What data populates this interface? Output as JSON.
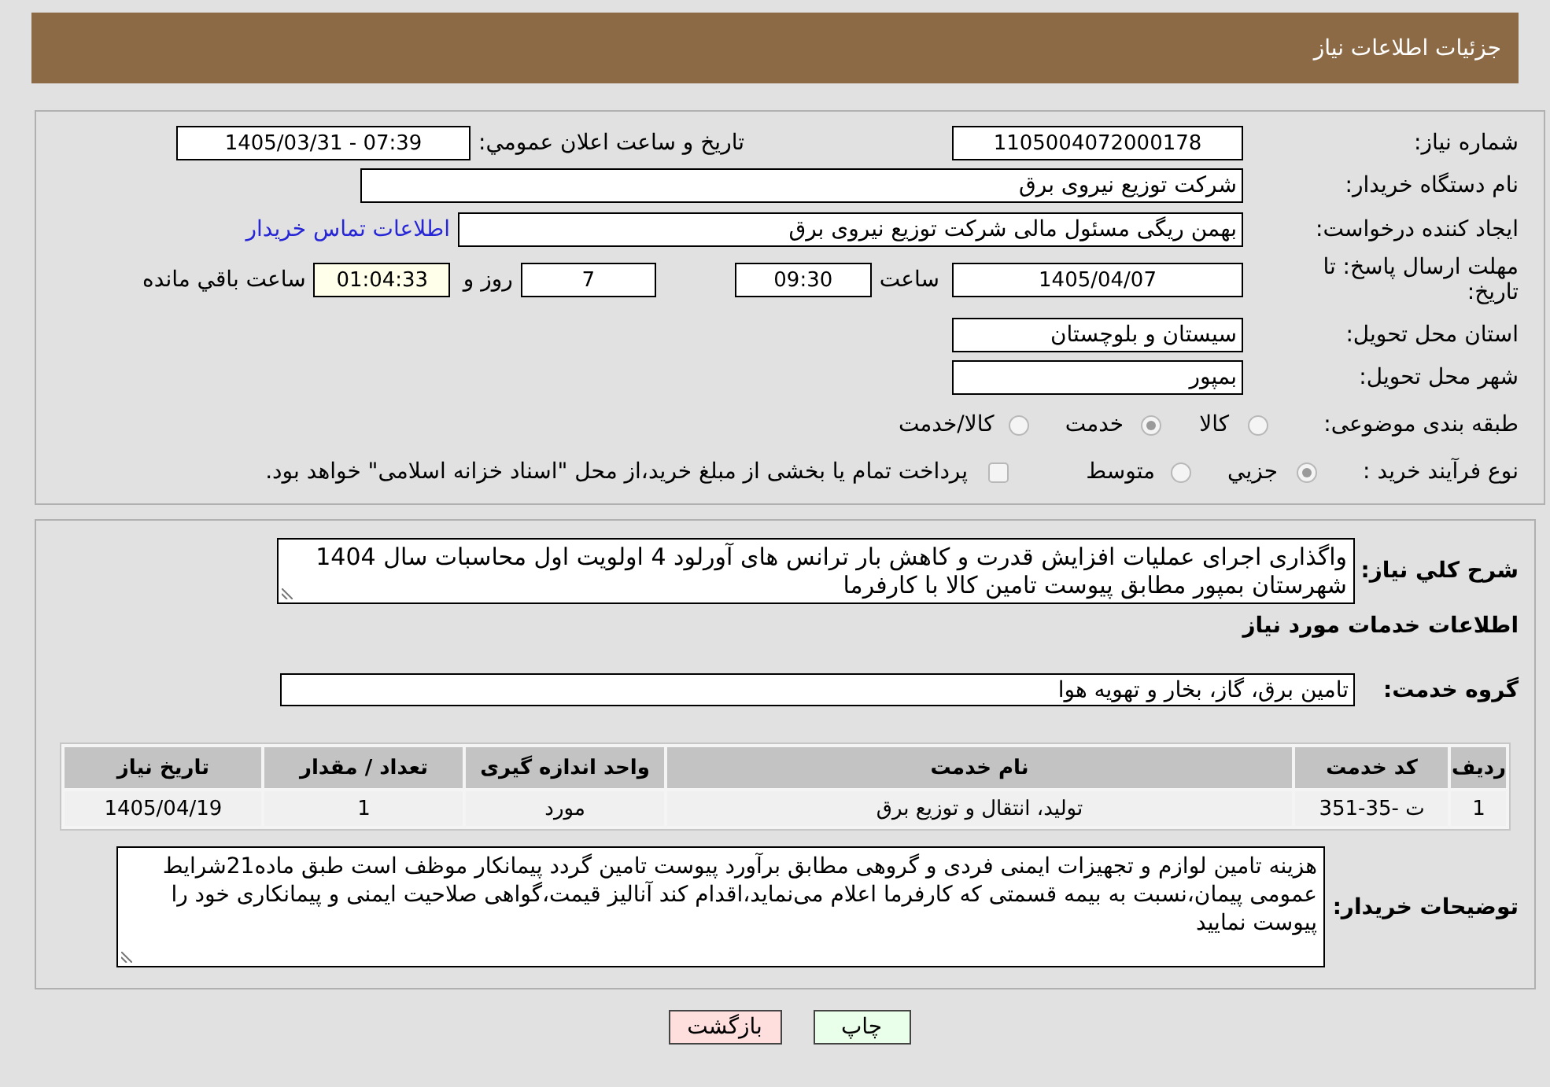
{
  "header": {
    "title": "جزئیات اطلاعات نیاز"
  },
  "details": {
    "need_number": {
      "label": "شماره نیاز:",
      "value": "1105004072000178"
    },
    "announce_datetime": {
      "label": "تاريخ و ساعت اعلان عمومي:",
      "value": "1405/03/31 - 07:39"
    },
    "buyer_org": {
      "label": "نام دستگاه خریدار:",
      "value": "شرکت توزیع نیروی برق"
    },
    "requester": {
      "label": "ایجاد کننده درخواست:",
      "value": "بهمن ریگی مسئول مالی شرکت توزیع نیروی برق",
      "link": "اطلاعات تماس خریدار"
    },
    "deadline": {
      "label": "مهلت ارسال پاسخ: تا تاریخ:",
      "date": "1405/04/07",
      "time_label": "ساعت",
      "time": "09:30",
      "days": "7",
      "days_label": "روز و",
      "remaining": "01:04:33",
      "remaining_label": "ساعت باقي مانده"
    },
    "province": {
      "label": "استان محل تحویل:",
      "value": "سیستان و بلوچستان"
    },
    "city": {
      "label": "شهر محل تحویل:",
      "value": "بمپور"
    },
    "category": {
      "label": "طبقه بندی موضوعی:",
      "options": [
        {
          "label": "کالا",
          "selected": false
        },
        {
          "label": "خدمت",
          "selected": true
        },
        {
          "label": "کالا/خدمت",
          "selected": false
        }
      ]
    },
    "purchase_type": {
      "label": "نوع فرآیند خرید :",
      "options": [
        {
          "label": "جزيي",
          "selected": true
        },
        {
          "label": "متوسط",
          "selected": false
        }
      ],
      "treasury": {
        "label": "پرداخت تمام یا بخشی از مبلغ خرید،از محل \"اسناد خزانه اسلامی\" خواهد بود.",
        "checked": false
      }
    }
  },
  "description": {
    "label": "شرح کلي نیاز:",
    "value": "واگذاری اجرای عملیات افزایش قدرت و کاهش بار ترانس های آورلود 4 اولویت اول محاسبات سال 1404 شهرستان بمپور مطابق پیوست تامین کالا با کارفرما"
  },
  "services": {
    "title": "اطلاعات خدمات مورد نیاز",
    "group_label": "گروه خدمت:",
    "group_value": "تامین برق، گاز، بخار و تهویه هوا",
    "table": {
      "columns": [
        "ردیف",
        "کد خدمت",
        "نام خدمت",
        "واحد اندازه گیری",
        "تعداد / مقدار",
        "تاریخ نیاز"
      ],
      "rows": [
        [
          "1",
          "ت -35-351",
          "تولید، انتقال و توزیع برق",
          "مورد",
          "1",
          "1405/04/19"
        ]
      ]
    }
  },
  "buyer_notes": {
    "label": "توضیحات خریدار:",
    "value": "هزینه تامین لوازم و تجهیزات ایمنی فردی و گروهی مطابق برآورد پیوست تامین گردد پیمانکار موظف است طبق ماده21شرایط عمومی پیمان،نسبت به بیمه قسمتی که کارفرما اعلام می‌نماید،اقدام کند آنالیز قیمت،گواهی صلاحیت ایمنی و پیمانکاری خود را پیوست نمایید"
  },
  "buttons": [
    {
      "label": "چاپ",
      "kind": "print"
    },
    {
      "label": "بازگشت",
      "kind": "back"
    }
  ]
}
